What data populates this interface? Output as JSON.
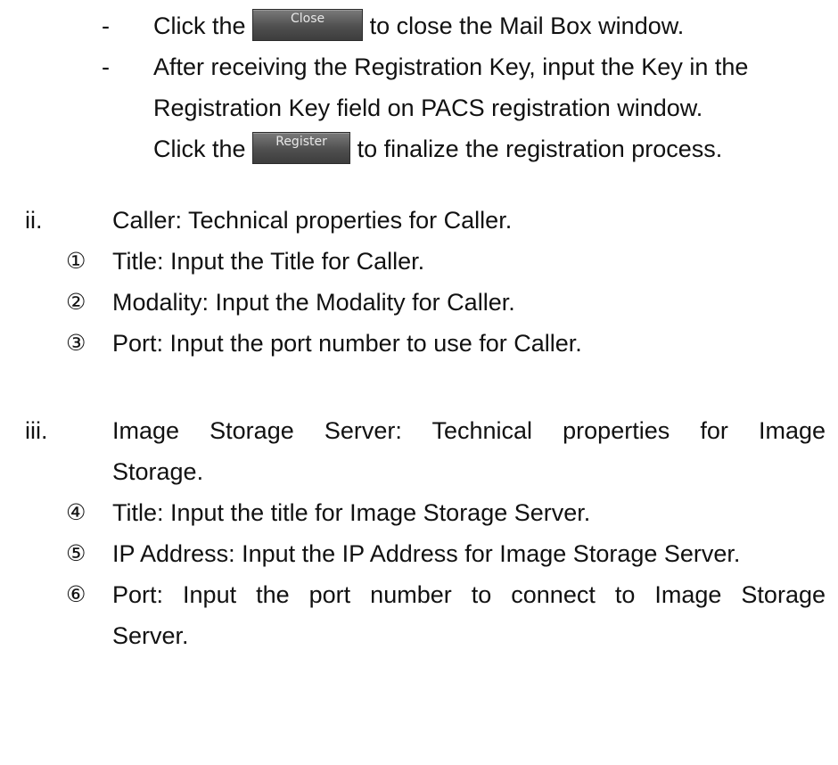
{
  "sub_bullets": [
    {
      "dash": "-",
      "pre": "Click the",
      "button": "Close",
      "post": "to close the Mail Box window."
    },
    {
      "dash": "-",
      "line1": "After receiving the Registration Key, input the Key in the",
      "line2": "Registration Key field on PACS registration window.",
      "pre": "Click the",
      "button": "Register",
      "post": "to finalize the registration process."
    }
  ],
  "section_ii": {
    "numeral": "ii.",
    "heading": "Caller: Technical properties for Caller.",
    "items": [
      {
        "marker": "①",
        "text": "Title: Input the Title for Caller."
      },
      {
        "marker": "②",
        "text": "Modality: Input the Modality for Caller."
      },
      {
        "marker": "③",
        "text": "Port: Input the port number to use for Caller."
      }
    ]
  },
  "section_iii": {
    "numeral": "iii.",
    "heading_line1": "Image Storage Server: Technical properties for Image",
    "heading_line2": "Storage.",
    "items": [
      {
        "marker": "④",
        "text": "Title: Input the title for Image Storage Server."
      },
      {
        "marker": "⑤",
        "text": "IP Address: Input the IP Address for Image Storage Server."
      },
      {
        "marker": "⑥",
        "text_line1": "Port: Input the port number to connect to Image Storage",
        "text_line2": "Server."
      }
    ]
  }
}
